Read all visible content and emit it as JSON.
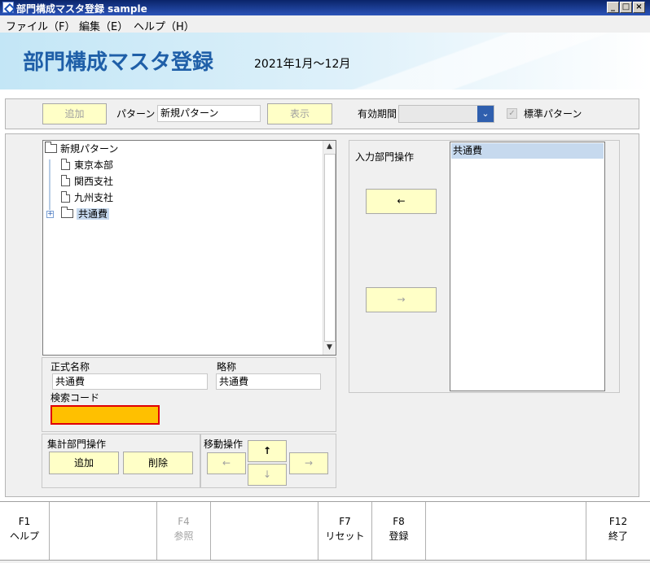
{
  "window": {
    "title": "部門構成マスタ登録 sample"
  },
  "menu": {
    "items": [
      "ファイル（F）",
      "編集（E）",
      "ヘルプ（H）"
    ]
  },
  "header": {
    "title": "部門構成マスタ登録",
    "period": "2021年1月～12月"
  },
  "toolbar": {
    "add_label": "追加",
    "pattern_label": "パターン",
    "pattern_value": "新規パターン",
    "show_label": "表示",
    "valid_period_label": "有効期間",
    "valid_period_value": "",
    "standard_pattern_label": "標準パターン",
    "standard_pattern_checked": true
  },
  "tree": {
    "root": "新規パターン",
    "children": [
      "東京本部",
      "関西支社",
      "九州支社",
      "共通費"
    ],
    "selected": "共通費"
  },
  "detail": {
    "official_name_label": "正式名称",
    "official_name_value": "共通費",
    "short_name_label": "略称",
    "short_name_value": "共通費",
    "search_code_label": "検索コード",
    "search_code_value": ""
  },
  "aggregate_ops": {
    "title": "集計部門操作",
    "add_label": "追加",
    "delete_label": "削除"
  },
  "move_ops": {
    "title": "移動操作",
    "up": "↑",
    "left": "←",
    "down": "↓",
    "right": "→"
  },
  "input_ops": {
    "title": "入力部門操作",
    "left_arrow": "←",
    "right_arrow": "→"
  },
  "input_list": {
    "items": [
      "共通費"
    ]
  },
  "fkeys": [
    {
      "key": "F1",
      "label": "ヘルプ"
    },
    {
      "key": "F4",
      "label": "参照"
    },
    {
      "key": "F7",
      "label": "リセット"
    },
    {
      "key": "F8",
      "label": "登録"
    },
    {
      "key": "F12",
      "label": "終了"
    }
  ],
  "colors": {
    "banner_title": "#1f5fa8",
    "button_bg": "#ffffc7",
    "selection": "#c6d9ee",
    "required_field": "#ffc000",
    "required_border": "#e00000"
  }
}
